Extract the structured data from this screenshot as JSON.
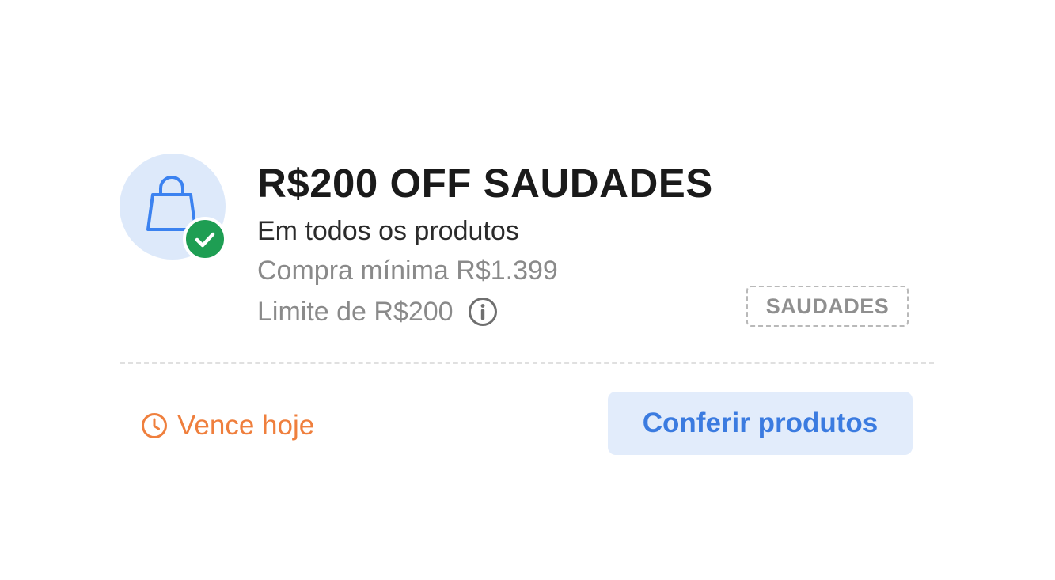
{
  "coupon": {
    "title": "R$200 OFF SAUDADES",
    "scope": "Em todos os produtos",
    "min_purchase": "Compra mínima R$1.399",
    "limit": "Limite de R$200",
    "code": "SAUDADES",
    "expiry": "Vence hoje",
    "cta_label": "Conferir produtos"
  },
  "icons": {
    "main": "shopping-bag-icon",
    "badge": "check-icon",
    "info": "info-icon",
    "expiry": "clock-icon"
  },
  "colors": {
    "title": "#1a1a1a",
    "muted": "#8a8a8a",
    "icon_bg": "#dde9fa",
    "bag_stroke": "#3b82f0",
    "check_green": "#1e9e53",
    "expiry_orange": "#ef7f3d",
    "cta_bg": "#e2ecfb",
    "cta_text": "#3b7be0"
  }
}
